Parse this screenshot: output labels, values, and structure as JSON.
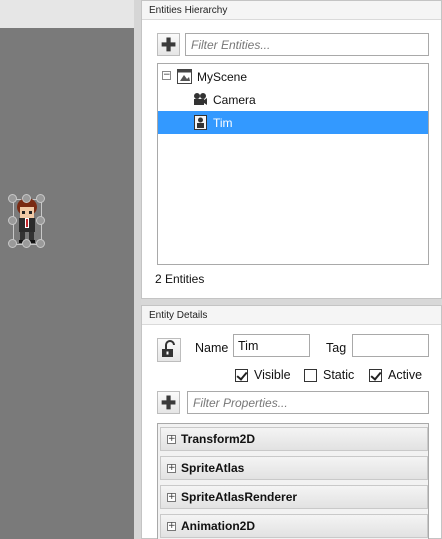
{
  "hierarchy": {
    "title": "Entities Hierarchy",
    "filter_placeholder": "Filter Entities...",
    "tree": [
      {
        "label": "MyScene",
        "icon": "scene-icon",
        "expander": "−",
        "selected": false
      },
      {
        "label": "Camera",
        "icon": "camera-icon",
        "selected": false
      },
      {
        "label": "Tim",
        "icon": "entity-icon",
        "selected": true
      }
    ],
    "status": "2 Entities"
  },
  "details": {
    "title": "Entity Details",
    "name_label": "Name",
    "name_value": "Tim",
    "tag_label": "Tag",
    "tag_value": "",
    "checkboxes": [
      {
        "label": "Visible",
        "checked": true
      },
      {
        "label": "Static",
        "checked": false
      },
      {
        "label": "Active",
        "checked": true
      }
    ],
    "filter_placeholder": "Filter Properties...",
    "components": [
      {
        "name": "Transform2D",
        "expander": "+"
      },
      {
        "name": "SpriteAtlas",
        "expander": "+"
      },
      {
        "name": "SpriteAtlasRenderer",
        "expander": "+"
      },
      {
        "name": "Animation2D",
        "expander": "+"
      }
    ]
  },
  "colors": {
    "selection": "#3399ff",
    "viewport": "#7a7a7a"
  }
}
